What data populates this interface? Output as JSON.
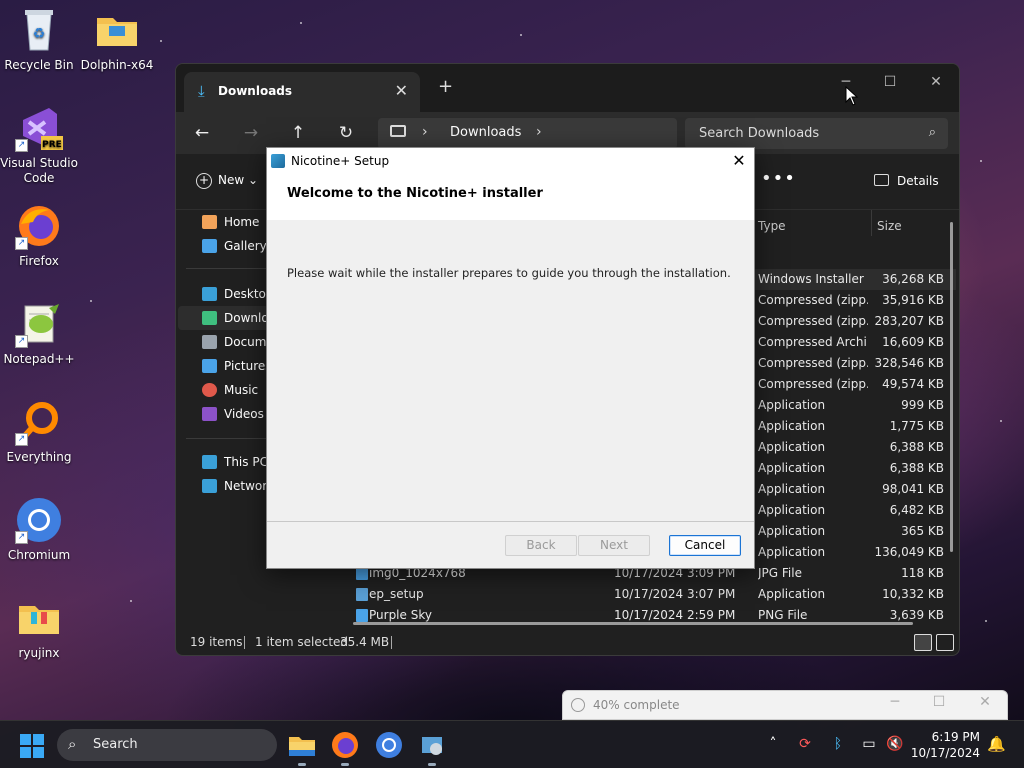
{
  "desktop": {
    "icons": [
      {
        "label": "Recycle Bin",
        "icon": "recycle-bin-icon"
      },
      {
        "label": "Dolphin-x64",
        "icon": "folder-icon"
      },
      {
        "label": "Visual Studio Code",
        "icon": "vscode-icon",
        "badge": "PRE"
      },
      {
        "label": "Firefox",
        "icon": "firefox-icon"
      },
      {
        "label": "Notepad++",
        "icon": "notepad-plus-plus-icon"
      },
      {
        "label": "Everything",
        "icon": "search-everything-icon"
      },
      {
        "label": "Chromium",
        "icon": "chromium-icon"
      },
      {
        "label": "ryujinx",
        "icon": "folder-icon"
      }
    ]
  },
  "explorer": {
    "tab_title": "Downloads",
    "breadcrumb": "Downloads",
    "search_placeholder": "Search Downloads",
    "cmd_new": "New",
    "cmd_details": "Details",
    "cmd_more": "•••",
    "sidebar": [
      {
        "label": "Home",
        "icon": "home-icon",
        "color": "#f2a35a"
      },
      {
        "label": "Gallery",
        "icon": "gallery-icon",
        "color": "#4aa3e8"
      },
      {
        "label": "Desktop",
        "icon": "desktop-folder-icon",
        "color": "#3aa0d8"
      },
      {
        "label": "Downloads",
        "icon": "download-icon",
        "color": "#3fbf7f"
      },
      {
        "label": "Documents",
        "icon": "documents-icon",
        "color": "#9aa3ad"
      },
      {
        "label": "Pictures",
        "icon": "pictures-icon",
        "color": "#4aa3e8"
      },
      {
        "label": "Music",
        "icon": "music-icon",
        "color": "#e0594b"
      },
      {
        "label": "Videos",
        "icon": "videos-icon",
        "color": "#8c52c8"
      },
      {
        "label": "This PC",
        "icon": "this-pc-icon",
        "color": "#3aa0d8"
      },
      {
        "label": "Network",
        "icon": "network-icon",
        "color": "#3aa0d8"
      }
    ],
    "columns": {
      "type": "Type",
      "size": "Size"
    },
    "rows": [
      {
        "name": "",
        "date": "",
        "type": "Windows Installer ...",
        "size": "36,268 KB",
        "selected": true
      },
      {
        "name": "",
        "date": "",
        "type": "Compressed (zipp...",
        "size": "35,916 KB"
      },
      {
        "name": "",
        "date": "",
        "type": "Compressed (zipp...",
        "size": "283,207 KB"
      },
      {
        "name": "",
        "date": "",
        "type": "Compressed Archi...",
        "size": "16,609 KB"
      },
      {
        "name": "",
        "date": "",
        "type": "Compressed (zipp...",
        "size": "328,546 KB"
      },
      {
        "name": "",
        "date": "",
        "type": "Compressed (zipp...",
        "size": "49,574 KB"
      },
      {
        "name": "",
        "date": "",
        "type": "Application",
        "size": "999 KB"
      },
      {
        "name": "",
        "date": "",
        "type": "Application",
        "size": "1,775 KB"
      },
      {
        "name": "",
        "date": "",
        "type": "Application",
        "size": "6,388 KB"
      },
      {
        "name": "",
        "date": "",
        "type": "Application",
        "size": "6,388 KB"
      },
      {
        "name": "",
        "date": "",
        "type": "Application",
        "size": "98,041 KB"
      },
      {
        "name": "",
        "date": "",
        "type": "Application",
        "size": "6,482 KB"
      },
      {
        "name": "",
        "date": "",
        "type": "Application",
        "size": "365 KB"
      },
      {
        "name": "",
        "date": "",
        "type": "Application",
        "size": "136,049 KB"
      },
      {
        "name": "img0_1024x768",
        "date": "10/17/2024 3:09 PM",
        "type": "JPG File",
        "size": "118 KB"
      },
      {
        "name": "ep_setup",
        "date": "10/17/2024 3:07 PM",
        "type": "Application",
        "size": "10,332 KB"
      },
      {
        "name": "Purple Sky",
        "date": "10/17/2024 2:59 PM",
        "type": "PNG File",
        "size": "3,639 KB"
      }
    ],
    "status": {
      "items": "19 items",
      "selected": "1 item selected",
      "size": "35.4 MB"
    }
  },
  "dialog": {
    "title": "Nicotine+ Setup",
    "heading": "Welcome to the Nicotine+ installer",
    "body": "Please wait while the installer prepares to guide you through the installation.",
    "back": "Back",
    "next": "Next",
    "cancel": "Cancel"
  },
  "progress": {
    "text": "40% complete",
    "value": 0.4
  },
  "taskbar": {
    "search_placeholder": "Search",
    "time": "6:19 PM",
    "date": "10/17/2024"
  }
}
